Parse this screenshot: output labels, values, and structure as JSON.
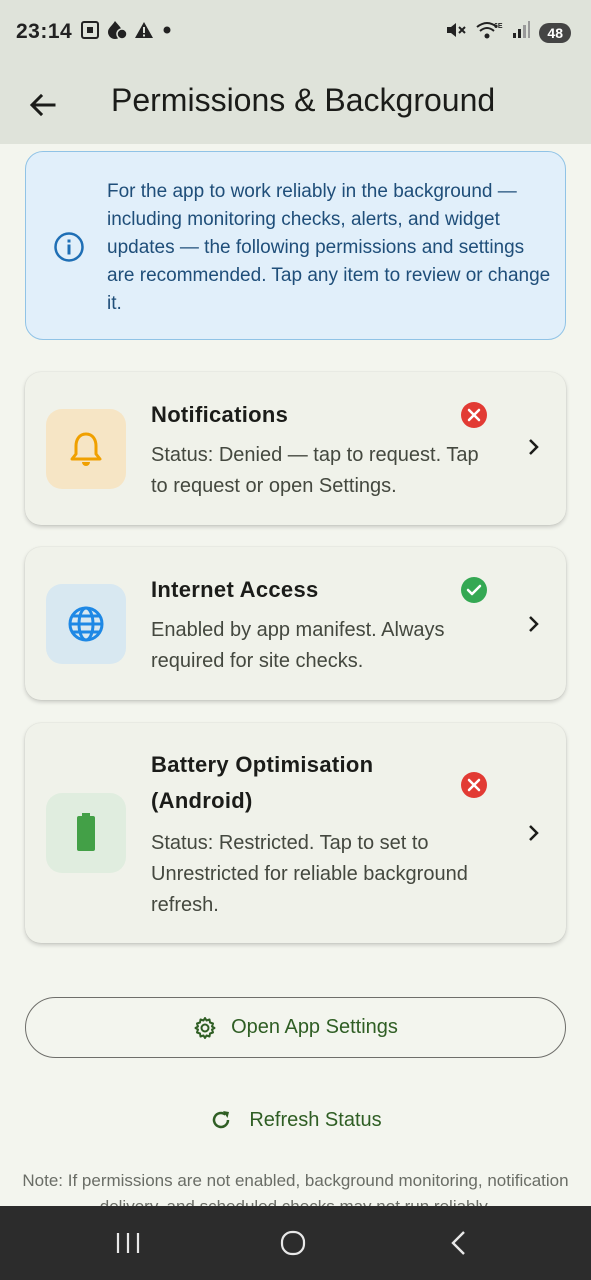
{
  "status_bar": {
    "time": "23:14",
    "left_icons": [
      "screenshot-icon",
      "flame-icon",
      "warning-icon",
      "dot-icon"
    ],
    "right_icons": [
      "mute-icon",
      "wifi-6e-icon",
      "signal-icon"
    ],
    "battery": "48"
  },
  "app_bar": {
    "title": "Permissions & Background"
  },
  "info": {
    "text": "For the app to work reliably in the background — including monitoring checks, alerts, and widget updates — the following permissions and settings are recommended. Tap any item to review or change it."
  },
  "permissions": [
    {
      "title": "Notifications",
      "description": "Status: Denied — tap to request. Tap to request or open Settings.",
      "icon": "bell-icon",
      "status": "denied"
    },
    {
      "title": "Internet Access",
      "description": "Enabled by app manifest. Always required for site checks.",
      "icon": "globe-icon",
      "status": "granted"
    },
    {
      "title": "Battery Optimisation (Android)",
      "description": "Status: Restricted. Tap to set to Unrestricted for reliable background refresh.",
      "icon": "battery-icon",
      "status": "denied"
    }
  ],
  "actions": {
    "open_settings": "Open App Settings",
    "refresh": "Refresh Status"
  },
  "note": "Note: If permissions are not enabled, background monitoring, notification delivery, and scheduled checks may not run reliably.",
  "colors": {
    "accent_green": "#2f5e24",
    "denied_red": "#e23b34",
    "granted_green": "#34a853",
    "info_blue": "#1f4e79"
  }
}
